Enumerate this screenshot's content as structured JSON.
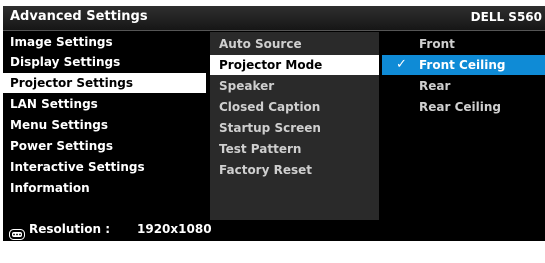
{
  "header": {
    "title": "Advanced Settings",
    "model": "DELL S560"
  },
  "left_menu": {
    "items": [
      {
        "label": "Image Settings",
        "selected": false
      },
      {
        "label": "Display Settings",
        "selected": false
      },
      {
        "label": "Projector Settings",
        "selected": true
      },
      {
        "label": "LAN Settings",
        "selected": false
      },
      {
        "label": "Menu Settings",
        "selected": false
      },
      {
        "label": "Power Settings",
        "selected": false
      },
      {
        "label": "Interactive Settings",
        "selected": false
      },
      {
        "label": "Information",
        "selected": false
      }
    ]
  },
  "middle_menu": {
    "items": [
      {
        "label": "Auto Source",
        "selected": false
      },
      {
        "label": "Projector Mode",
        "selected": true
      },
      {
        "label": "Speaker",
        "selected": false
      },
      {
        "label": "Closed Caption",
        "selected": false
      },
      {
        "label": "Startup Screen",
        "selected": false
      },
      {
        "label": "Test Pattern",
        "selected": false
      },
      {
        "label": "Factory Reset",
        "selected": false
      }
    ]
  },
  "options": {
    "items": [
      {
        "label": "Front",
        "selected": false
      },
      {
        "label": "Front Ceiling",
        "selected": true,
        "check": "✓"
      },
      {
        "label": "Rear",
        "selected": false
      },
      {
        "label": "Rear Ceiling",
        "selected": false
      }
    ]
  },
  "status": {
    "icon": "resolution-port-icon",
    "label": "Resolution :",
    "value": "1920x1080"
  },
  "colors": {
    "highlight": "#0f8bd6",
    "selected_bg": "#ffffff",
    "panel": "#2a2a2a",
    "osd_bg": "#000000"
  }
}
